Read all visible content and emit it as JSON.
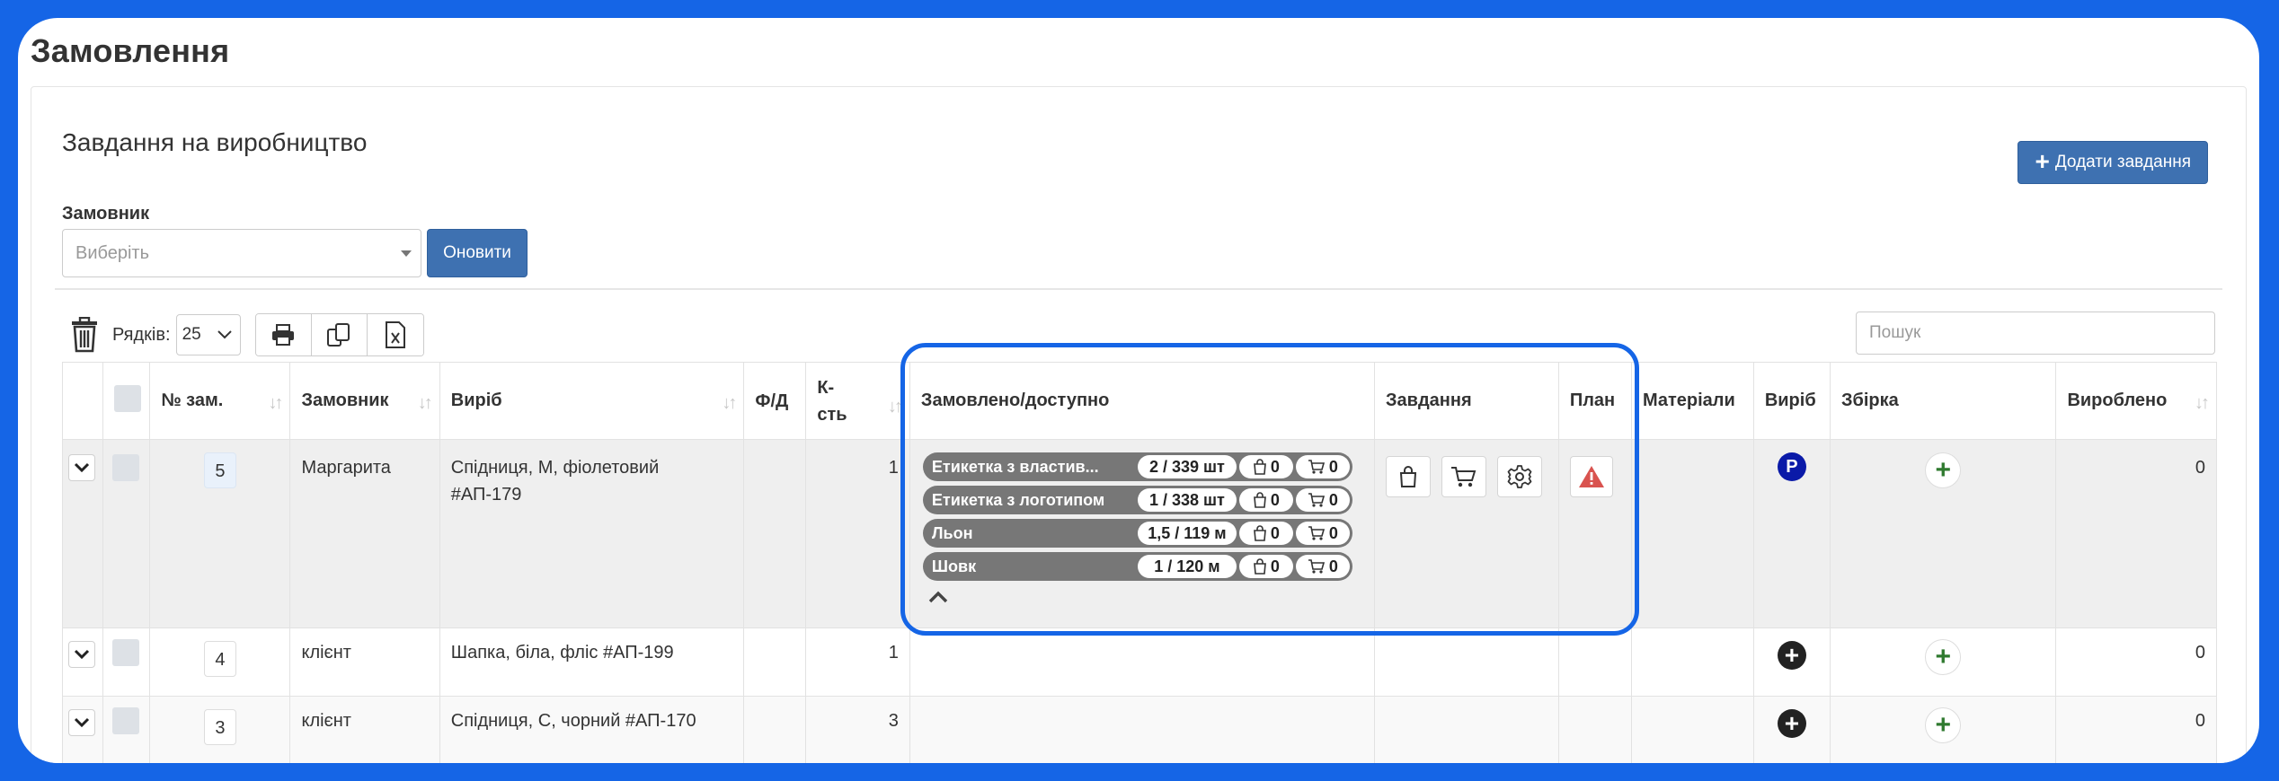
{
  "page": {
    "title": "Замовлення"
  },
  "panel": {
    "title": "Завдання на виробництво",
    "add_task_label": "Додати завдання",
    "customer_label": "Замовник",
    "customer_placeholder": "Виберіть",
    "refresh_label": "Оновити"
  },
  "toolbar": {
    "rows_label": "Рядків:",
    "rows_value": "25",
    "search_placeholder": "Пошук"
  },
  "table": {
    "headers": {
      "order_no": "№ зам.",
      "customer": "Замовник",
      "product": "Виріб",
      "fd": "Ф/Д",
      "qty": "К-сть",
      "ordered": "Замовлено/доступно",
      "tasks": "Завдання",
      "plan": "План",
      "materials": "Матеріали",
      "product2": "Виріб",
      "assembly": "Збірка",
      "produced": "Вироблено"
    },
    "rows": [
      {
        "order_no": "5",
        "customer": "Маргарита",
        "product": "Спідниця, М, фіолетовий #АП-179",
        "qty": "1",
        "produced": "0",
        "product_badge": "P",
        "materials": [
          {
            "name": "Етикетка з властив...",
            "qty": "2 / 339 шт",
            "bag": "0",
            "cart": "0"
          },
          {
            "name": "Етикетка з логотипом",
            "qty": "1 / 338 шт",
            "bag": "0",
            "cart": "0"
          },
          {
            "name": "Льон",
            "qty": "1,5 / 119 м",
            "bag": "0",
            "cart": "0"
          },
          {
            "name": "Шовк",
            "qty": "1 / 120 м",
            "bag": "0",
            "cart": "0"
          }
        ]
      },
      {
        "order_no": "4",
        "customer": "клієнт",
        "product": "Шапка, біла, фліс #АП-199",
        "qty": "1",
        "produced": "0"
      },
      {
        "order_no": "3",
        "customer": "клієнт",
        "product": "Спідниця, С, чорний #АП-170",
        "qty": "3",
        "produced": "0"
      }
    ]
  },
  "colors": {
    "accent": "#1565e6",
    "button": "#3e71b1",
    "pill": "#777777",
    "badge_blue": "#0a1aa8",
    "warning": "#d9534f"
  }
}
